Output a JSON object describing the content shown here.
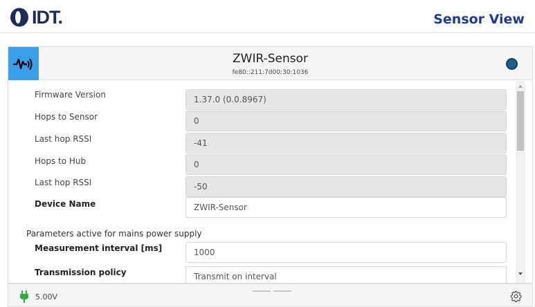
{
  "header": {
    "brand": "IDT.",
    "title": "Sensor View"
  },
  "device": {
    "name": "ZWIR-Sensor",
    "address": "fe80::211:7d00:30:1036",
    "status_color": "#1f5f8c",
    "icon": "sensor-signal-icon"
  },
  "info_fields": [
    {
      "label": "Firmware Version",
      "value": "1.37.0 (0.0.8967)"
    },
    {
      "label": "Hops to Sensor",
      "value": "0"
    },
    {
      "label": "Last hop RSSI",
      "value": "-41"
    },
    {
      "label": "Hops to Hub",
      "value": "0"
    },
    {
      "label": "Last hop RSSI",
      "value": "-50"
    }
  ],
  "device_name_field": {
    "label": "Device Name",
    "value": "ZWIR-Sensor"
  },
  "mains_section": {
    "title": "Parameters active for mains power supply",
    "measurement_interval": {
      "label": "Measurement interval [ms]",
      "value": "1000"
    },
    "transmission_policy": {
      "label": "Transmission policy",
      "value": "Transmit on interval"
    }
  },
  "footer": {
    "power_icon": "plug-icon",
    "power_value": "5.00V",
    "settings_icon": "gear-icon"
  },
  "colors": {
    "accent": "#3a9fe6",
    "title": "#1f3a93",
    "power": "#2fae3a"
  }
}
